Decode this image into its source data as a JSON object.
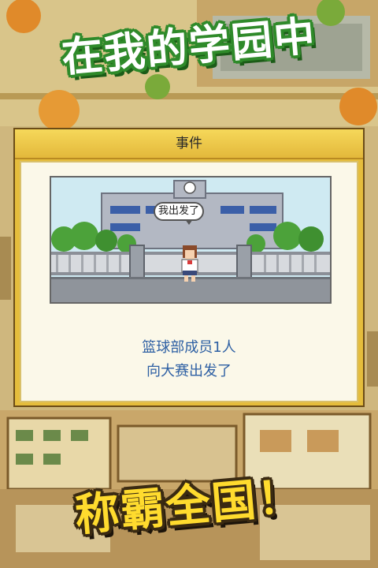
{
  "banner": {
    "top_text": "在我的学园中",
    "bottom_text": "称霸全国！"
  },
  "dialog": {
    "title": "事件",
    "speech_bubble": "我出发了",
    "message_line1": "篮球部成员1人",
    "message_line2": "向大赛出发了"
  },
  "colors": {
    "top_banner_fill": "#ffffff",
    "top_banner_outline": "#2f8a2a",
    "bottom_banner_fill": "#ffdb2e",
    "dialog_frame": "#e5bd3c",
    "message_text": "#2d5fa3"
  }
}
